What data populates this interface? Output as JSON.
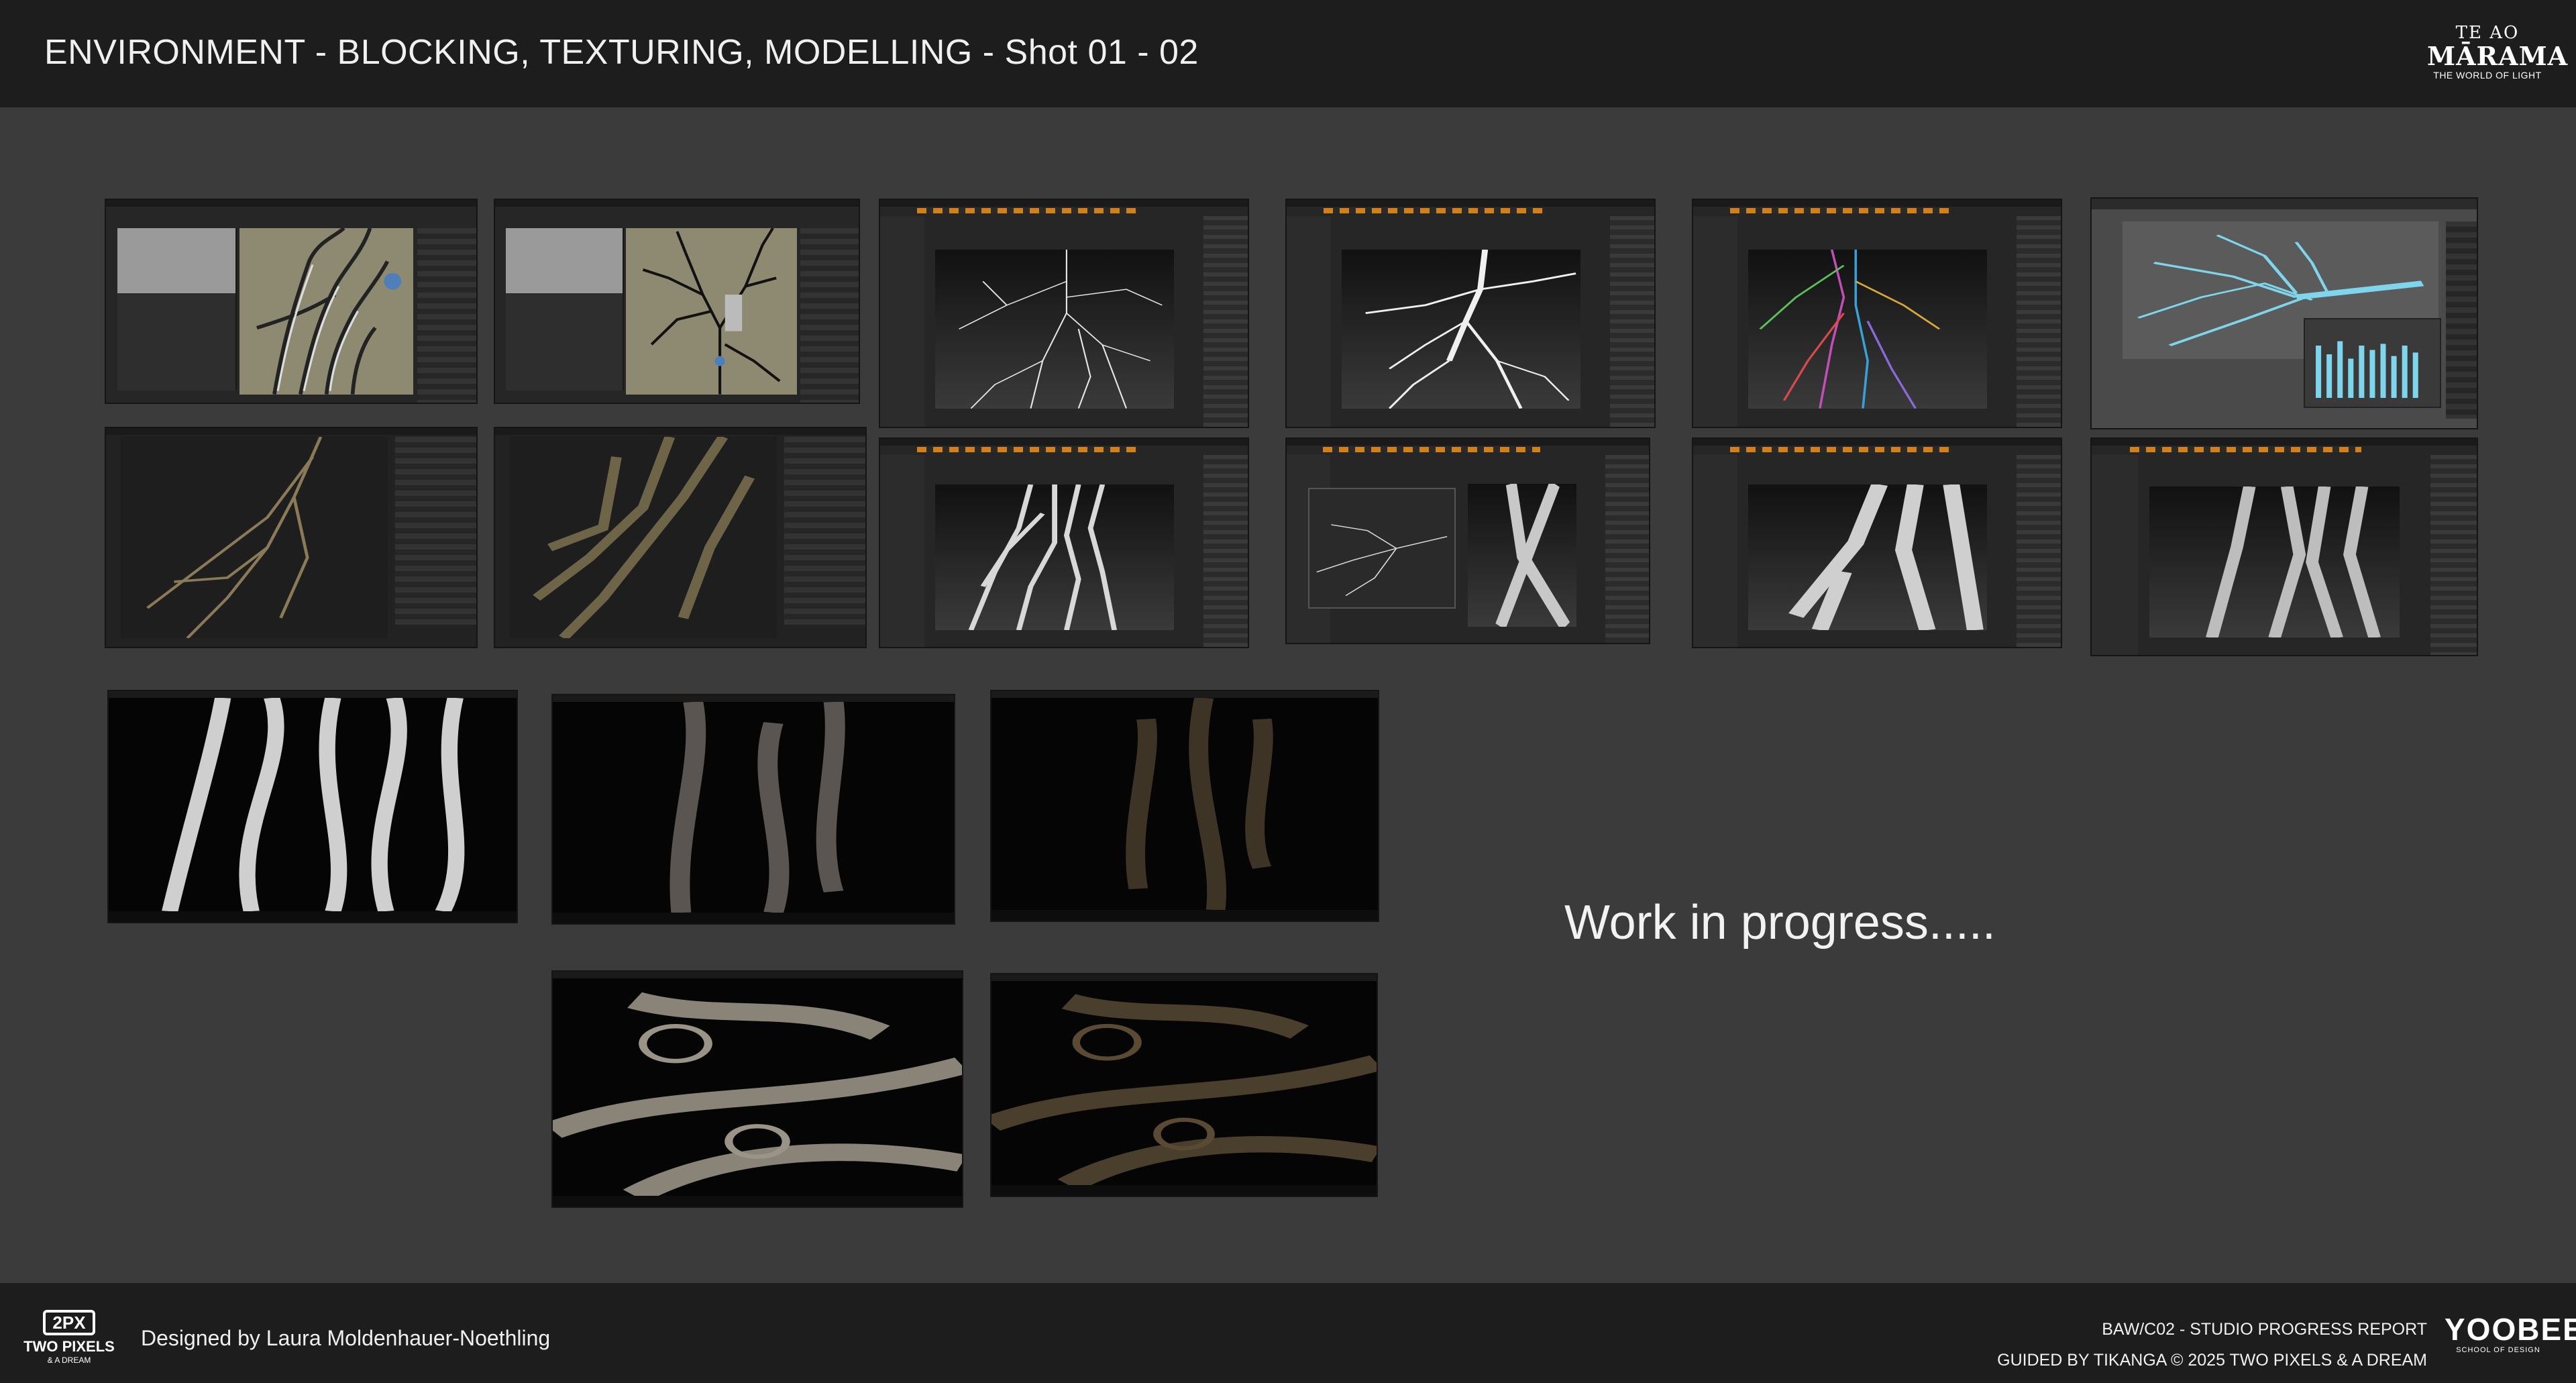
{
  "header": {
    "title": "ENVIRONMENT - BLOCKING, TEXTURING, MODELLING - Shot 01 - 02",
    "logo": {
      "line1": "TE AO",
      "line2": "MĀRAMA",
      "line3": "THE WORLD OF LIGHT"
    }
  },
  "main": {
    "wip_text": "Work in progress.....",
    "thumbnails": [
      "Houdini root layout 01",
      "Houdini root layout 02",
      "ZBrush root silhouette 01",
      "ZBrush root silhouette 02",
      "ZBrush polygroups",
      "Maya curves blockout",
      "Substance texturing 01",
      "Substance texturing 02",
      "ZBrush roots sculpt 01",
      "ZBrush roots sculpt 02",
      "ZBrush roots sculpt 03",
      "ZBrush roots sculpt 04",
      "Viewport render clay",
      "Viewport render lit 01",
      "Viewport render lit 02",
      "Render spiral roots 01",
      "Render spiral roots 02"
    ]
  },
  "footer": {
    "twopx": {
      "badge": "2PX",
      "name": "TWO PIXELS",
      "sub": "& A DREAM"
    },
    "designed_by": "Designed by Laura Moldenhauer-Noethling",
    "report_line1": "BAW/C02 - STUDIO PROGRESS REPORT",
    "report_line2": "GUIDED BY TIKANGA © 2025 TWO PIXELS & A DREAM",
    "yoobee": {
      "name": "YOOBEE",
      "sub": "SCHOOL OF DESIGN"
    }
  },
  "colors": {
    "header_bg": "#1d1d1d",
    "page_bg": "#3b3b3b",
    "accent": "#d2801c"
  }
}
